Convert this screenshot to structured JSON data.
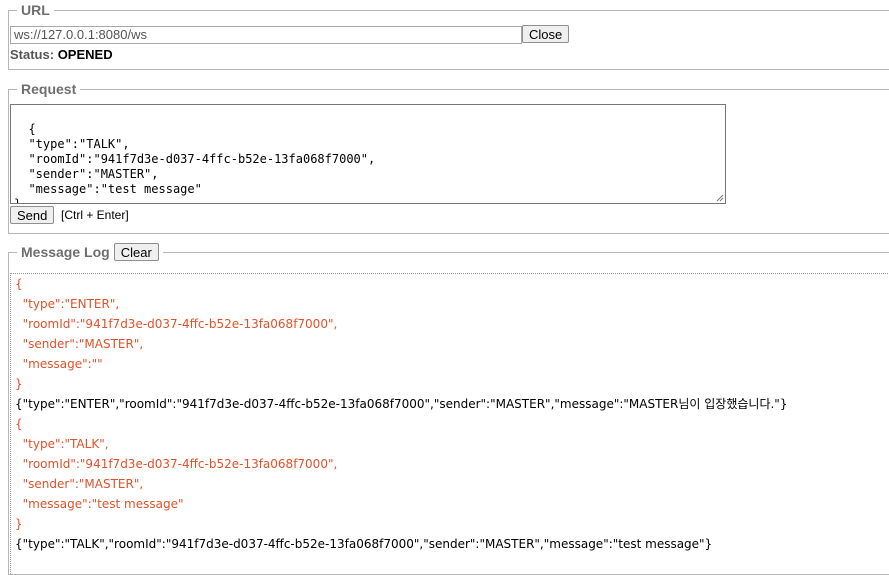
{
  "url_section": {
    "legend": "URL",
    "url_value": "ws://127.0.0.1:8080/ws",
    "close_label": "Close",
    "status_label": "Status:",
    "status_value": "OPENED"
  },
  "request_section": {
    "legend": "Request",
    "body": "{\n  \"type\":\"TALK\",\n  \"roomId\":\"941f7d3e-d037-4ffc-b52e-13fa068f7000\",\n  \"sender\":\"MASTER\",\n  \"message\":\"test message\"\n}",
    "send_label": "Send",
    "hint": "[Ctrl + Enter]"
  },
  "log_section": {
    "legend": "Message Log",
    "clear_label": "Clear",
    "lines": [
      {
        "kind": "sent",
        "text": "{"
      },
      {
        "kind": "sent",
        "text": "  \"type\":\"ENTER\","
      },
      {
        "kind": "sent",
        "text": "  \"roomId\":\"941f7d3e-d037-4ffc-b52e-13fa068f7000\","
      },
      {
        "kind": "sent",
        "text": "  \"sender\":\"MASTER\","
      },
      {
        "kind": "sent",
        "text": "  \"message\":\"\""
      },
      {
        "kind": "sent",
        "text": "}"
      },
      {
        "kind": "recv",
        "text": "{\"type\":\"ENTER\",\"roomId\":\"941f7d3e-d037-4ffc-b52e-13fa068f7000\",\"sender\":\"MASTER\",\"message\":\"MASTER님이 입장했습니다.\"}"
      },
      {
        "kind": "sent",
        "text": "{"
      },
      {
        "kind": "sent",
        "text": "  \"type\":\"TALK\","
      },
      {
        "kind": "sent",
        "text": "  \"roomId\":\"941f7d3e-d037-4ffc-b52e-13fa068f7000\","
      },
      {
        "kind": "sent",
        "text": "  \"sender\":\"MASTER\","
      },
      {
        "kind": "sent",
        "text": "  \"message\":\"test message\""
      },
      {
        "kind": "sent",
        "text": "}"
      },
      {
        "kind": "recv",
        "text": "{\"type\":\"TALK\",\"roomId\":\"941f7d3e-d037-4ffc-b52e-13fa068f7000\",\"sender\":\"MASTER\",\"message\":\"test message\"}"
      }
    ]
  },
  "colors": {
    "sent_text": "#e0522a",
    "received_text": "#000000"
  }
}
